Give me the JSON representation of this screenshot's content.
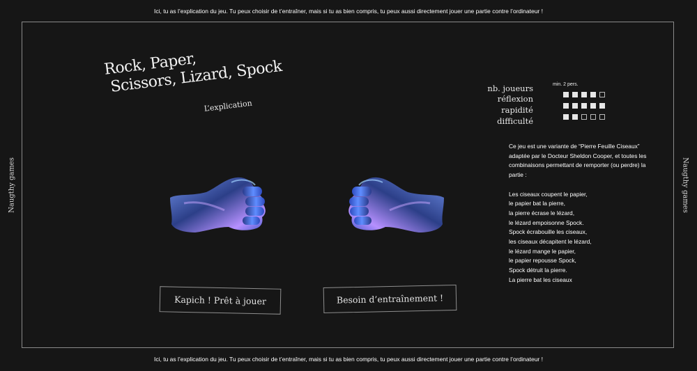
{
  "banner": {
    "top_text": "Ici, tu as l’explication du jeu. Tu peux choisir de t’entraîner, mais si tu as bien compris, tu peux aussi directement jouer une partie contre l’ordinateur !",
    "bottom_text": "Ici, tu as l’explication du jeu. Tu peux choisir de t’entraîner, mais si tu as bien compris, tu peux aussi directement jouer une partie contre l’ordinateur !"
  },
  "side_labels": {
    "left": "Naugthy games",
    "right": "Naugthy games"
  },
  "game": {
    "title_line1": "Rock, Paper,",
    "title_line2": "Scissors, Lizard, Spock",
    "subtitle": "L’explication"
  },
  "stats": {
    "players_label": "nb. joueurs",
    "players_note": "min. 2 pers.",
    "reflexion_label": "réflexion",
    "reflexion_level": 4,
    "rapidite_label": "rapidité",
    "rapidite_level": 5,
    "difficulte_label": "difficulté",
    "difficulte_level": 2,
    "max_level": 5
  },
  "description": {
    "intro": "Ce jeu est une variante de “Pierre Feuille Ciseaux” adaptée par le Docteur Sheldon Cooper, et toutes les combinaisons permettant de remporter (ou perdre) la partie :",
    "rules": [
      "Les ciseaux coupent le papier,",
      "le papier bat la pierre,",
      "la pierre écrase le lézard,",
      "le lézard empoisonne Spock.",
      "Spock écrabouille les ciseaux,",
      "les ciseaux décapitent le lézard,",
      "le lézard mange le papier,",
      "le papier repousse Spock,",
      "Spock détruit la pierre.",
      "La pierre bat les ciseaux"
    ]
  },
  "buttons": {
    "play_label": "Kapich ! Prêt à jouer",
    "train_label": "Besoin d’entraînement !"
  },
  "colors": {
    "background": "#161616",
    "frame": "#8a8a8a",
    "fist_blue": "#4f86ff",
    "fist_purple": "#b690ff",
    "fist_dark": "#1c2550"
  }
}
